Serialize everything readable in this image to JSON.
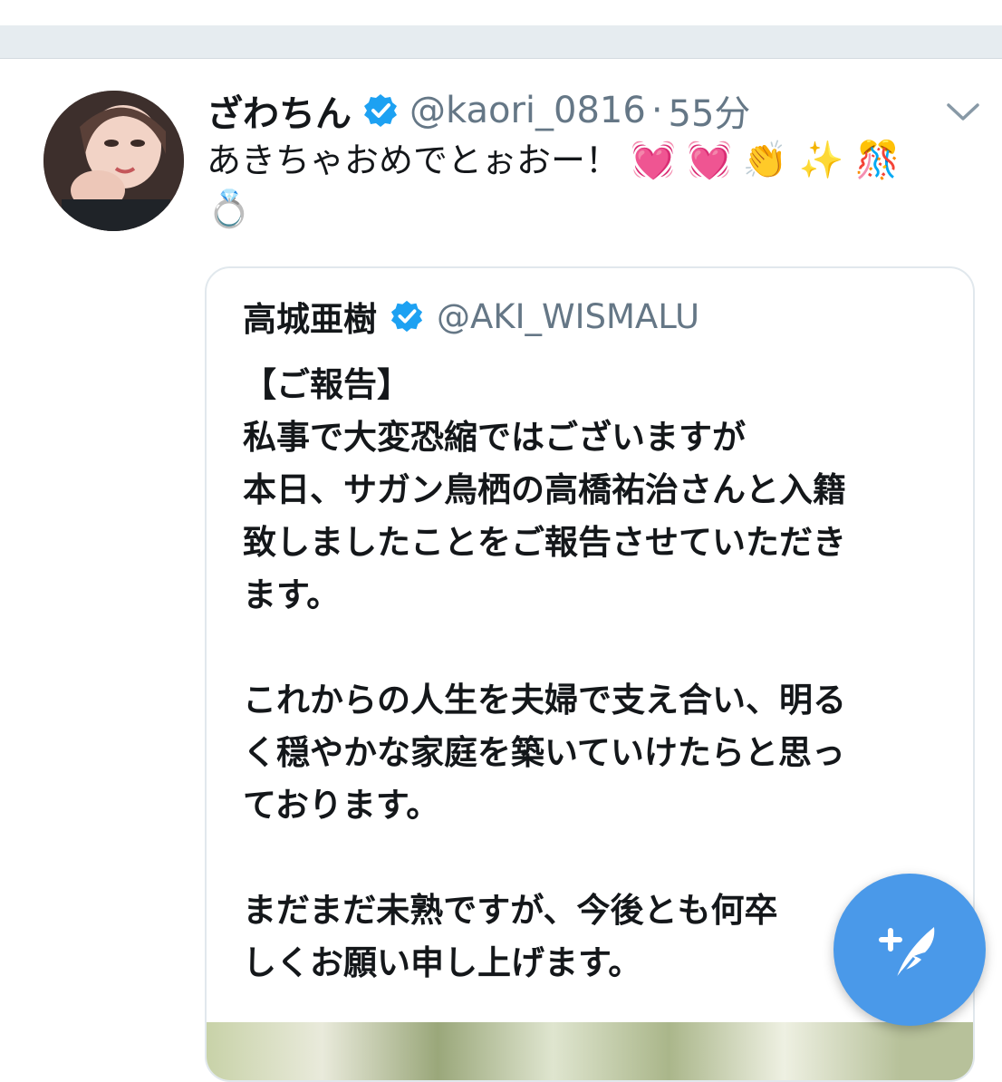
{
  "tweet": {
    "display_name": "ざわちん",
    "handle": "@kaori_0816",
    "separator": "·",
    "time": "55分",
    "text": "あきちゃおめでとぉおー！",
    "emojis": [
      "💓",
      "💓",
      "👏",
      "✨",
      "🎊",
      "💍"
    ]
  },
  "quoted_tweet": {
    "display_name": "高城亜樹",
    "handle": "@AKI_WISMALU",
    "body": "【ご報告】\n私事で大変恐縮ではございますが\n本日、サガン鳥栖の高橋祐治さんと入籍\n致しましたことをご報告させていただき\nます。\n\nこれからの人生を夫婦で支え合い、明る\nく穏やかな家庭を築いていけたらと思っ\nております。\n\nまだまだ未熟ですが、今後とも何卒\nしくお願い申し上げます。"
  },
  "colors": {
    "accent": "#1da1f2",
    "fab": "#4a99e9",
    "muted": "#657786",
    "text": "#14171a"
  },
  "icons": {
    "verified": "verified-badge-icon",
    "caret": "chevron-down-icon",
    "compose": "compose-feather-icon"
  }
}
